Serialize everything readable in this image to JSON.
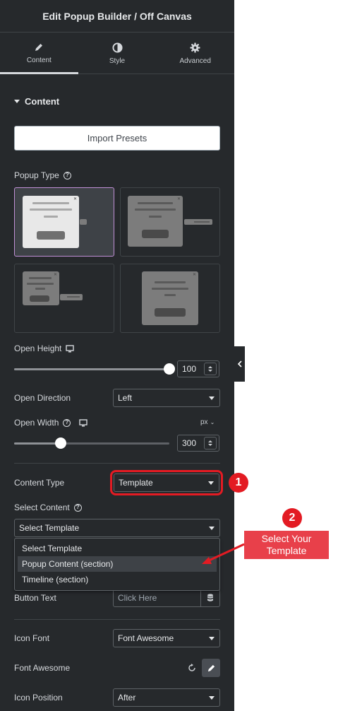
{
  "header": {
    "title": "Edit Popup Builder / Off Canvas"
  },
  "tabs": [
    {
      "label": "Content",
      "icon": "pencil-icon",
      "active": true
    },
    {
      "label": "Style",
      "icon": "contrast-icon",
      "active": false
    },
    {
      "label": "Advanced",
      "icon": "gear-icon",
      "active": false
    }
  ],
  "section": {
    "title": "Content"
  },
  "import_presets": {
    "label": "Import Presets"
  },
  "popup_type": {
    "label": "Popup Type",
    "selected_index": 0
  },
  "open_height": {
    "label": "Open Height",
    "value": "100",
    "percent": 100
  },
  "open_direction": {
    "label": "Open Direction",
    "value": "Left"
  },
  "open_width": {
    "label": "Open Width",
    "unit": "px",
    "value": "300",
    "percent": 30
  },
  "content_type": {
    "label": "Content Type",
    "value": "Template"
  },
  "select_content": {
    "label": "Select Content",
    "value": "Select Template",
    "options": [
      "Select Template",
      "Popup Content (section)",
      "Timeline (section)"
    ],
    "hovered_index": 1
  },
  "button_text": {
    "label": "Button Text",
    "placeholder": "Click Here"
  },
  "icon_font": {
    "label": "Icon Font",
    "value": "Font Awesome"
  },
  "font_awesome": {
    "label": "Font Awesome"
  },
  "icon_position": {
    "label": "Icon Position",
    "value": "After"
  },
  "annotations": {
    "step1": "1",
    "step2": "2",
    "callout_line1": "Select Your",
    "callout_line2": "Template",
    "color": "#e31b23"
  },
  "colors": {
    "panel_bg": "#26292c",
    "accent_selected": "#c08fd6"
  }
}
